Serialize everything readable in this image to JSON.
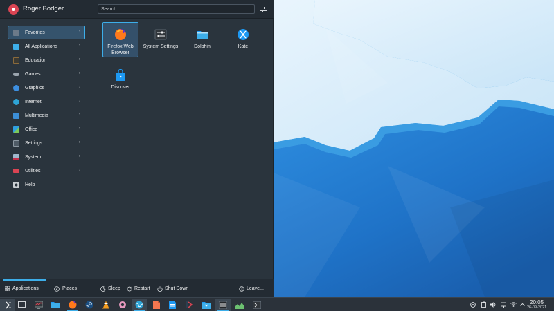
{
  "user": {
    "name": "Roger Bodger"
  },
  "search": {
    "placeholder": "Search..."
  },
  "categories": [
    {
      "label": "Favorites",
      "icon": "star-folder-icon",
      "color": "#6c7a89",
      "arrow": "›"
    },
    {
      "label": "All Applications",
      "icon": "grid-icon",
      "color": "#3daee9",
      "arrow": "›"
    },
    {
      "label": "Education",
      "icon": "blackboard-icon",
      "color": "#8a6a3b",
      "arrow": "›"
    },
    {
      "label": "Games",
      "icon": "gamepad-icon",
      "color": "#9aa4ad",
      "arrow": "›"
    },
    {
      "label": "Graphics",
      "icon": "palette-icon",
      "color": "#3d8fe0",
      "arrow": "›"
    },
    {
      "label": "Internet",
      "icon": "globe-icon",
      "color": "#2ea4d6",
      "arrow": "›"
    },
    {
      "label": "Multimedia",
      "icon": "media-icon",
      "color": "#3c8fd8",
      "arrow": "›"
    },
    {
      "label": "Office",
      "icon": "office-icon",
      "color": "#2f9fe0",
      "arrow": "›"
    },
    {
      "label": "Settings",
      "icon": "settings-icon",
      "color": "#4f5b66",
      "arrow": "›"
    },
    {
      "label": "System",
      "icon": "system-icon",
      "color": "#c5304b",
      "arrow": "›"
    },
    {
      "label": "Utilities",
      "icon": "toolbox-icon",
      "color": "#da4453",
      "arrow": "›"
    },
    {
      "label": "Help",
      "icon": "help-icon",
      "color": "#c9ced3",
      "arrow": ""
    }
  ],
  "favorites": [
    {
      "label": "Firefox Web Browser",
      "icon": "firefox-icon"
    },
    {
      "label": "System Settings",
      "icon": "system-settings-icon"
    },
    {
      "label": "Dolphin",
      "icon": "dolphin-folder-icon"
    },
    {
      "label": "Kate",
      "icon": "kate-icon"
    },
    {
      "label": "Discover",
      "icon": "discover-icon"
    }
  ],
  "footer": {
    "tabs": [
      {
        "label": "Applications",
        "icon": "grid-icon"
      },
      {
        "label": "Places",
        "icon": "compass-icon"
      }
    ],
    "actions": {
      "sleep": "Sleep",
      "restart": "Restart",
      "shutdown": "Shut Down",
      "leave": "Leave..."
    }
  },
  "taskbar": {
    "apps": [
      {
        "name": "Application Launcher",
        "icon": "kde-launcher-icon"
      },
      {
        "name": "Desktop",
        "icon": "show-desktop-icon"
      },
      {
        "name": "System Monitor",
        "icon": "system-monitor-icon"
      },
      {
        "name": "Dolphin",
        "icon": "dolphin-folder-icon"
      },
      {
        "name": "Firefox",
        "icon": "firefox-icon"
      },
      {
        "name": "Steam",
        "icon": "steam-icon"
      },
      {
        "name": "VLC",
        "icon": "vlc-cone-icon"
      },
      {
        "name": "Tellico",
        "icon": "tellico-icon"
      },
      {
        "name": "Web Browser",
        "icon": "globe-icon"
      },
      {
        "name": "Document Viewer",
        "icon": "document-orange-icon"
      },
      {
        "name": "Writer",
        "icon": "document-blue-icon"
      },
      {
        "name": "Version Control",
        "icon": "git-icon"
      },
      {
        "name": "Kontact",
        "icon": "mail-folder-icon"
      },
      {
        "name": "Terminal Settings",
        "icon": "terminal-settings-icon"
      },
      {
        "name": "Charts",
        "icon": "chart-icon"
      },
      {
        "name": "Terminal",
        "icon": "terminal-icon"
      }
    ],
    "tray": [
      "help-icon",
      "clipboard-icon",
      "volume-icon",
      "network-icon",
      "wifi-icon",
      "expand-tray-icon"
    ],
    "clock": {
      "time": "20:05",
      "date": "26-09-2021"
    }
  },
  "colors": {
    "accent": "#3daee9",
    "panel": "#2a343d"
  }
}
